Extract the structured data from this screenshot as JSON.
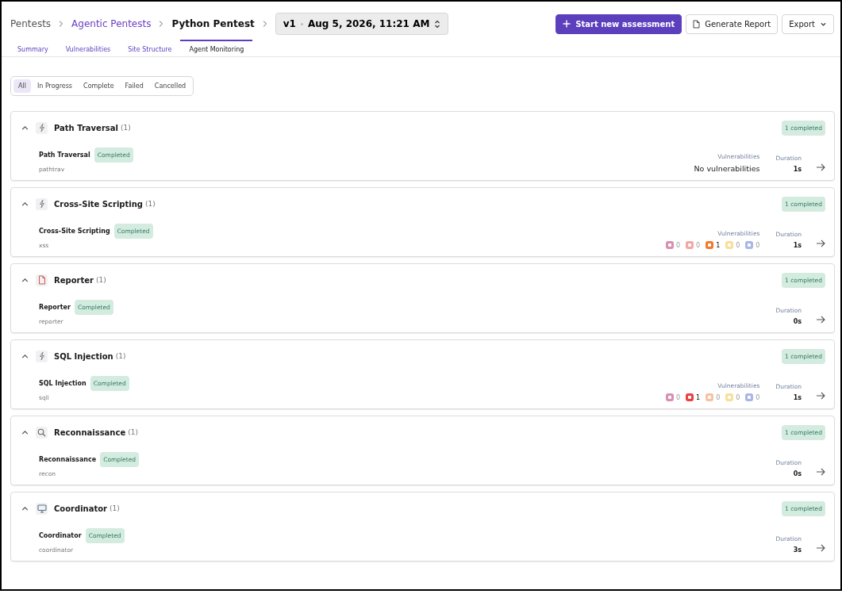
{
  "breadcrumbs": [
    {
      "label": "Pentests",
      "kind": "muted"
    },
    {
      "label": "Agentic Pentests",
      "kind": "link"
    },
    {
      "label": "Python Pentest",
      "kind": "current"
    }
  ],
  "version": {
    "number": "v1",
    "date": "Aug 5, 2026, 11:21 AM"
  },
  "actions": [
    {
      "label": "Start new assessment",
      "kind": "primary"
    },
    {
      "label": "Generate Report",
      "kind": "report"
    },
    {
      "label": "Export",
      "kind": "menu"
    }
  ],
  "tabs": [
    {
      "label": "Summary",
      "selected": false
    },
    {
      "label": "Vulnerabilities",
      "selected": false
    },
    {
      "label": "Site Structure",
      "selected": false
    },
    {
      "label": "Agent Monitoring",
      "selected": true
    }
  ],
  "filters": [
    {
      "label": "All",
      "selected": true
    },
    {
      "label": "In Progress",
      "selected": false
    },
    {
      "label": "Complete",
      "selected": false
    },
    {
      "label": "Failed",
      "selected": false
    },
    {
      "label": "Cancelled",
      "selected": false
    }
  ],
  "groups": [
    {
      "kind": "bolt",
      "title": "Path Traversal",
      "count": "(1)",
      "expanded": true,
      "summary": "1 completed",
      "agents": [
        {
          "name": "Path Traversal",
          "status": "Completed",
          "id": "pathtrav",
          "vulnerabilities_label": "Vulnerabilities",
          "vulnerabilities_text": "No vulnerabilities",
          "duration_label": "Duration",
          "duration": "1s"
        }
      ]
    },
    {
      "kind": "bolt",
      "title": "Cross-Site Scripting",
      "count": "(1)",
      "expanded": true,
      "summary": "1 completed",
      "agents": [
        {
          "name": "Cross-Site Scripting",
          "status": "Completed",
          "id": "xss",
          "vulnerabilities_label": "Vulnerabilities",
          "vulnerabilities": [
            {
              "color": "#d98fb3",
              "count": "0",
              "highlighted": false
            },
            {
              "color": "#f4a5a5",
              "count": "0",
              "highlighted": false
            },
            {
              "color": "#f07b2e",
              "count": "1",
              "highlighted": true
            },
            {
              "color": "#f8df9a",
              "count": "0",
              "highlighted": false
            },
            {
              "color": "#a9b6e6",
              "count": "0",
              "highlighted": false
            }
          ],
          "duration_label": "Duration",
          "duration": "1s"
        }
      ]
    },
    {
      "kind": "file",
      "title": "Reporter",
      "count": "(1)",
      "expanded": true,
      "summary": "1 completed",
      "agents": [
        {
          "name": "Reporter",
          "status": "Completed",
          "id": "reporter",
          "duration_label": "Duration",
          "duration": "0s"
        }
      ]
    },
    {
      "kind": "bolt",
      "title": "SQL Injection",
      "count": "(1)",
      "expanded": true,
      "summary": "1 completed",
      "agents": [
        {
          "name": "SQL Injection",
          "status": "Completed",
          "id": "sqli",
          "vulnerabilities_label": "Vulnerabilities",
          "vulnerabilities": [
            {
              "color": "#d98fb3",
              "count": "0",
              "highlighted": false
            },
            {
              "color": "#ef3f3f",
              "count": "1",
              "highlighted": true
            },
            {
              "color": "#f8c2a0",
              "count": "0",
              "highlighted": false
            },
            {
              "color": "#f8df9a",
              "count": "0",
              "highlighted": false
            },
            {
              "color": "#a9b6e6",
              "count": "0",
              "highlighted": false
            }
          ],
          "duration_label": "Duration",
          "duration": "1s"
        }
      ]
    },
    {
      "kind": "search",
      "title": "Reconnaissance",
      "count": "(1)",
      "expanded": true,
      "summary": "1 completed",
      "agents": [
        {
          "name": "Reconnaissance",
          "status": "Completed",
          "id": "recon",
          "duration_label": "Duration",
          "duration": "0s"
        }
      ]
    },
    {
      "kind": "monitor",
      "title": "Coordinator",
      "count": "(1)",
      "expanded": true,
      "summary": "1 completed",
      "agents": [
        {
          "name": "Coordinator",
          "status": "Completed",
          "id": "coordinator",
          "duration_label": "Duration",
          "duration": "3s"
        }
      ]
    }
  ]
}
